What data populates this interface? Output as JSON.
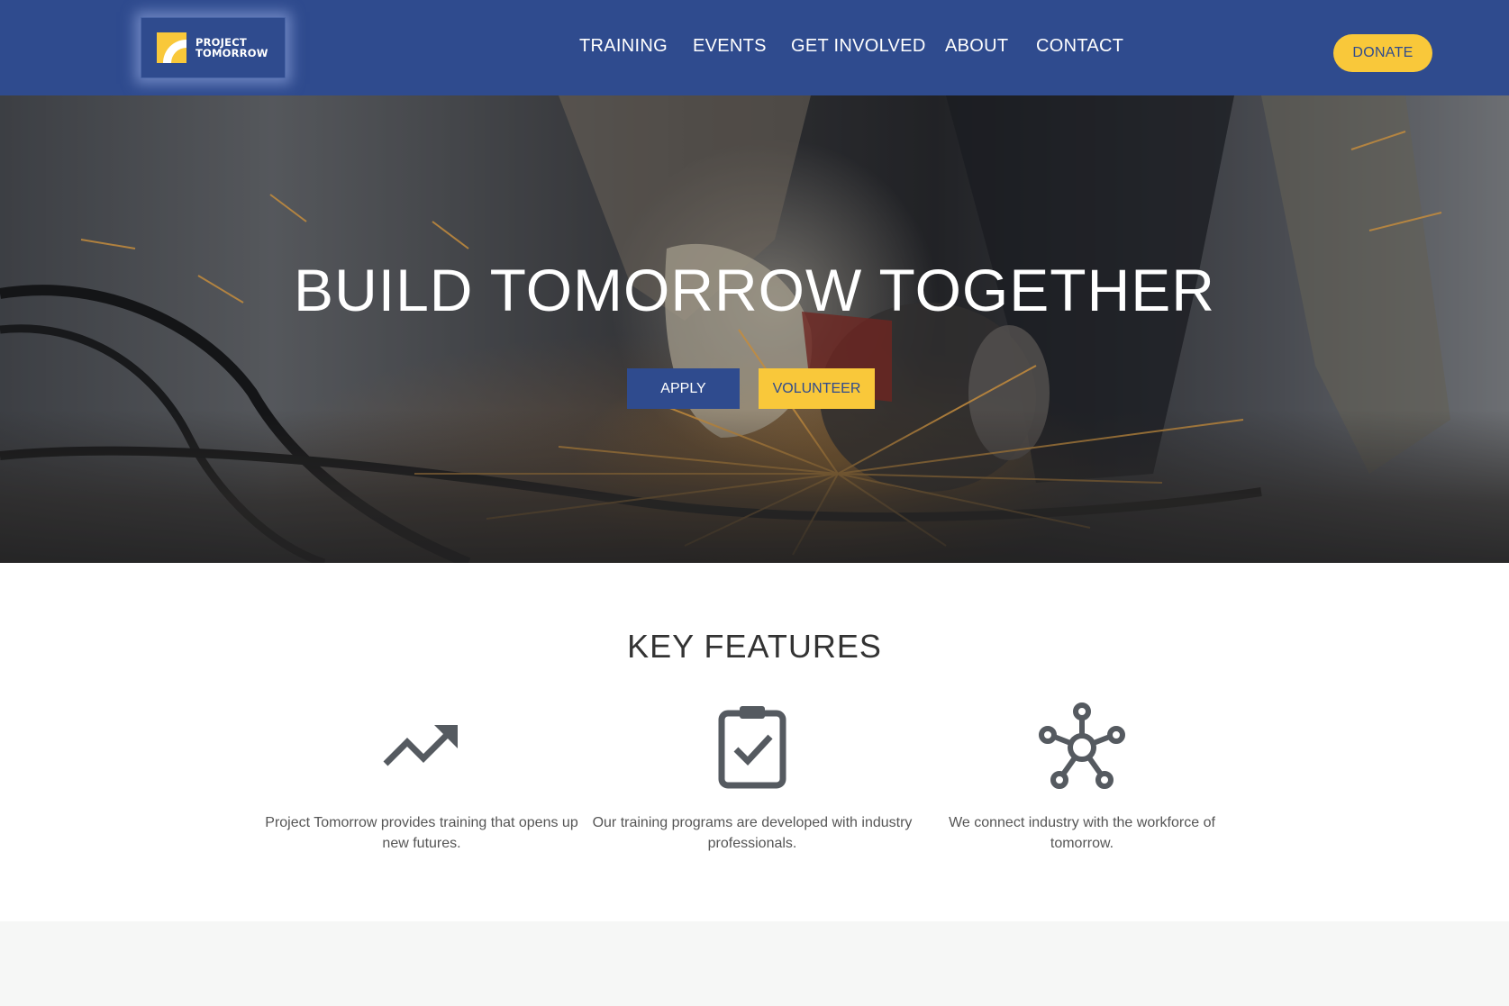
{
  "header": {
    "logo_line1": "PROJECT",
    "logo_line2": "TOMORROW",
    "nav": [
      "TRAINING",
      "EVENTS",
      "GET INVOLVED",
      "ABOUT",
      "CONTACT"
    ],
    "donate_label": "DONATE"
  },
  "hero": {
    "title": "BUILD TOMORROW TOGETHER",
    "apply_label": "APPLY",
    "volunteer_label": "VOLUNTEER"
  },
  "features": {
    "title": "KEY FEATURES",
    "items": [
      {
        "icon": "trending-up-icon",
        "text": "Project Tomorrow provides training that opens up new futures."
      },
      {
        "icon": "clipboard-check-icon",
        "text": "Our training programs are developed with industry professionals."
      },
      {
        "icon": "network-hub-icon",
        "text": "We connect industry with the workforce of tomorrow."
      }
    ]
  },
  "colors": {
    "brand_blue": "#2f4b8e",
    "accent_yellow": "#f9c83a",
    "icon_gray": "#555a60"
  }
}
